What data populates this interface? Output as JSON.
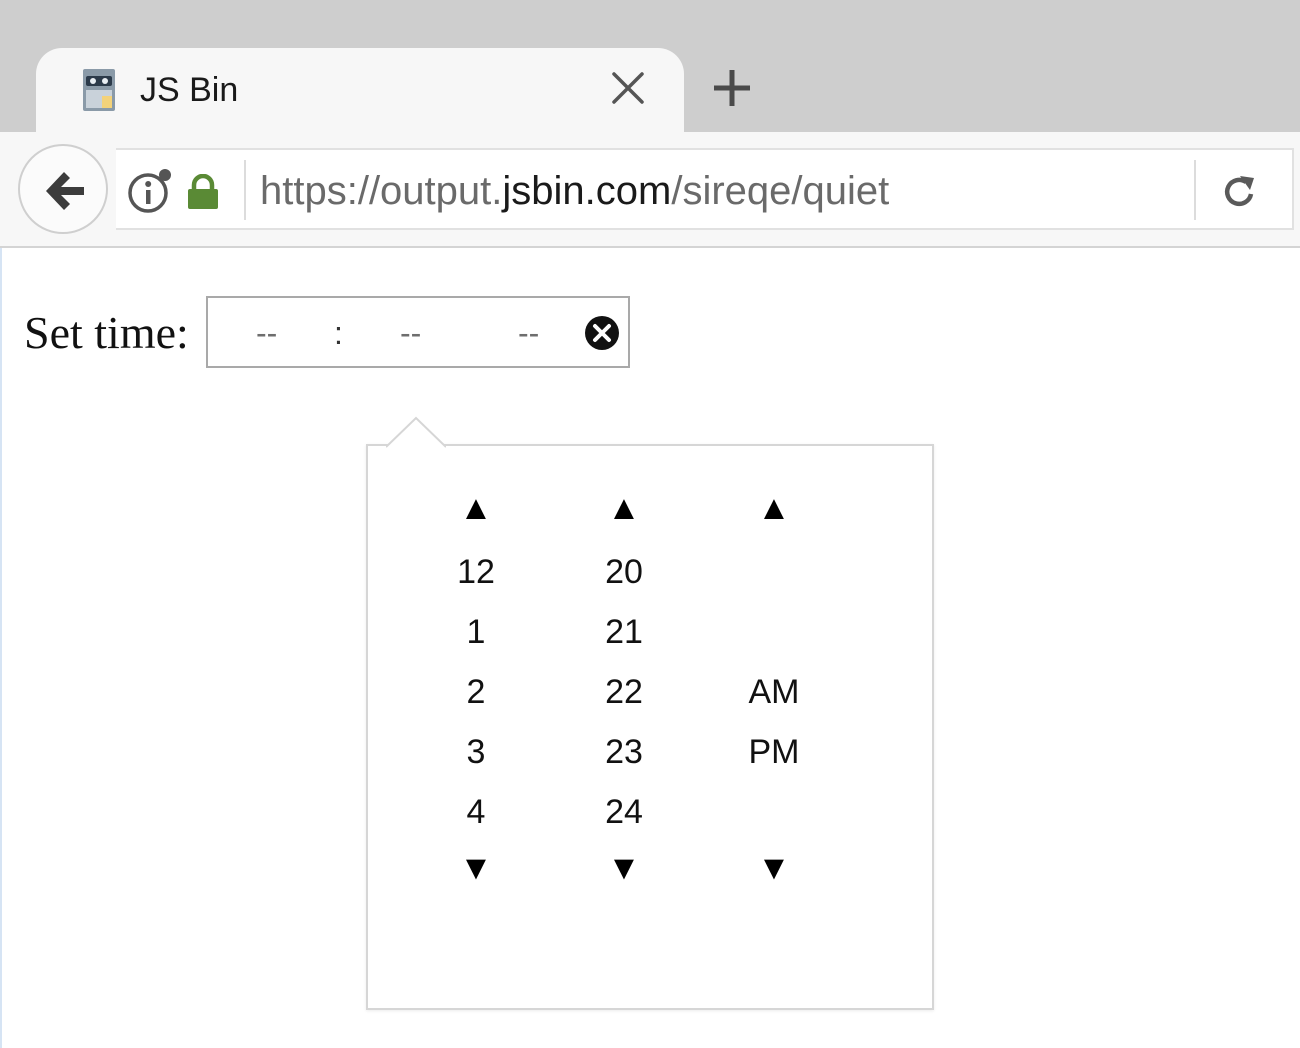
{
  "browser": {
    "tab": {
      "title": "JS Bin"
    },
    "url": {
      "prefix": "https://output.",
      "domain": "jsbin.com",
      "path": "/sireqe/quiet"
    }
  },
  "page": {
    "label": "Set time:",
    "input": {
      "hour": "--",
      "separator": ":",
      "minute": "--",
      "ampm": "--"
    }
  },
  "picker": {
    "up_arrow": "▲",
    "down_arrow": "▼",
    "hours": [
      "12",
      "1",
      "2",
      "3",
      "4"
    ],
    "minutes": [
      "20",
      "21",
      "22",
      "23",
      "24"
    ],
    "ampm": [
      "AM",
      "PM"
    ]
  },
  "colors": {
    "tabstrip": "#cecece",
    "toolbar": "#f7f7f7",
    "lock": "#5a8a35",
    "url_muted": "#6a6a6a"
  }
}
